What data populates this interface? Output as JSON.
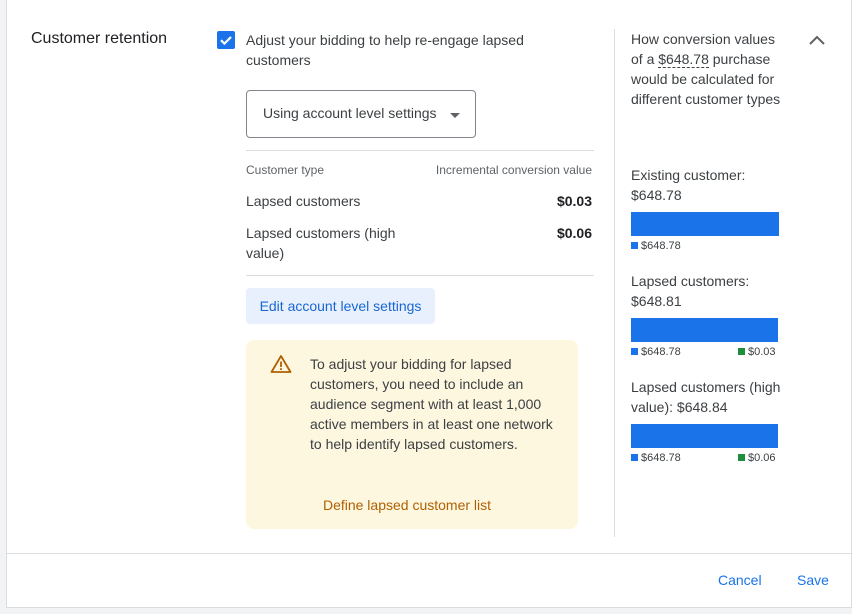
{
  "section": {
    "title": "Customer retention"
  },
  "checkbox": {
    "checked": true,
    "label": "Adjust your bidding to help re-engage lapsed customers"
  },
  "select": {
    "value": "Using account level settings"
  },
  "table": {
    "headers": [
      "Customer type",
      "Incremental conversion value"
    ],
    "rows": [
      {
        "type": "Lapsed customers",
        "value": "$0.03"
      },
      {
        "type": "Lapsed customers (high value)",
        "value": "$0.06"
      }
    ]
  },
  "edit_button": "Edit account level settings",
  "warning": {
    "icon": "warning-triangle-icon",
    "text": "To adjust your bidding for lapsed customers, you need to include an audience segment with at least 1,000 active members in at least one network to help identify lapsed customers.",
    "link": "Define lapsed customer list"
  },
  "sidebar": {
    "title_pre": "How conversion values of a ",
    "title_amount": "$648.78",
    "title_post": " purchase would be calculated for different customer types",
    "segments": [
      {
        "label": "Existing customer: $648.78",
        "base_label": "$648.78",
        "base_fraction": 1.0,
        "extra_label": ""
      },
      {
        "label": "Lapsed customers: $648.81",
        "base_label": "$648.78",
        "base_fraction": 0.99,
        "extra_label": "$0.03"
      },
      {
        "label": "Lapsed customers (high value): $648.84",
        "base_label": "$648.78",
        "base_fraction": 0.99,
        "extra_label": "$0.06"
      }
    ]
  },
  "footer": {
    "cancel": "Cancel",
    "save": "Save"
  },
  "colors": {
    "accent": "#1a73e8",
    "extra": "#1e8e3e",
    "warning_bg": "#fef7e0",
    "warning_text": "#b06000"
  },
  "icons": {
    "collapse": "chevron-up-icon",
    "checkbox": "check-icon",
    "dropdown": "caret-down-icon"
  }
}
